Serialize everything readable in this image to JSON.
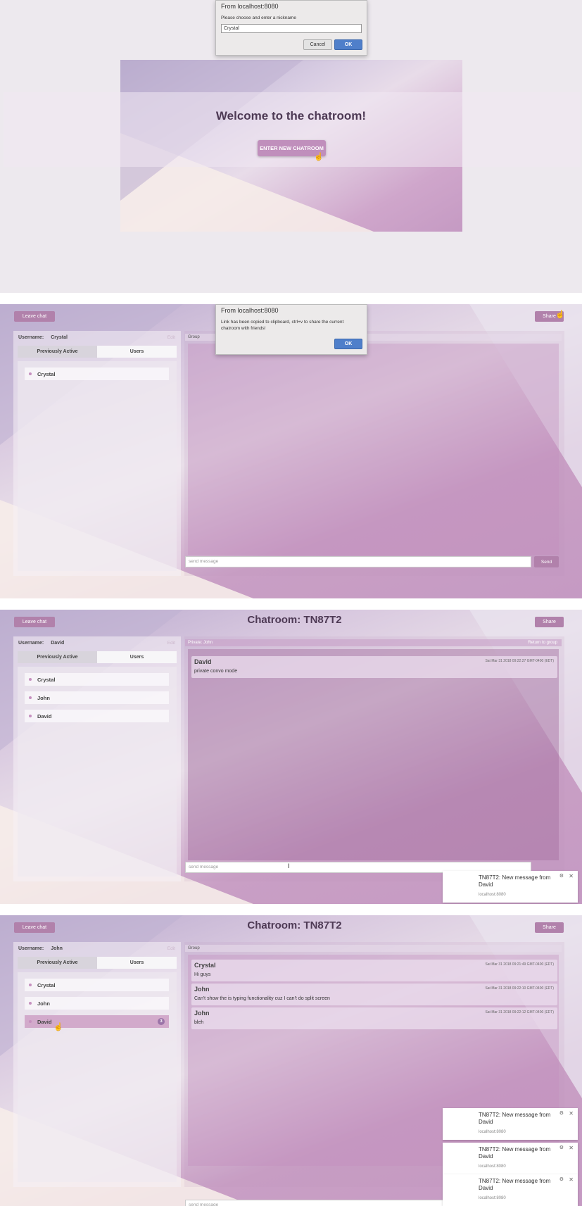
{
  "panel1": {
    "dialog": {
      "title": "From localhost:8080",
      "message": "Please choose and enter a nickname",
      "input_value": "Crystal",
      "cancel": "Cancel",
      "ok": "OK"
    },
    "welcome": "Welcome to the chatroom!",
    "enter_button": "ENTER NEW CHATROOM"
  },
  "panel2": {
    "leave": "Leave chat",
    "share": "Share",
    "dialog": {
      "title": "From localhost:8080",
      "message": "Link has been copied to clipboard, ctrl+v to share the current chatroom with friends!",
      "ok": "OK"
    },
    "username_label": "Username:",
    "username": "Crystal",
    "edit": "Edit",
    "tabs": [
      "Previously Active",
      "Users"
    ],
    "users": [
      "Crystal"
    ],
    "chat_header": "Group",
    "send_placeholder": "send message",
    "send": "Send"
  },
  "panel3": {
    "leave": "Leave chat",
    "title": "Chatroom: TN87T2",
    "share": "Share",
    "username_label": "Username:",
    "username": "David",
    "edit": "Edit",
    "tabs": [
      "Previously Active",
      "Users"
    ],
    "users": [
      "Crystal",
      "John",
      "David"
    ],
    "chat_header": "Private: John",
    "return_link": "Return to group",
    "messages": [
      {
        "who": "David",
        "ts": "Sat Mar 31 2018 09:22:27 GMT-0400 (EDT)",
        "text": "private convo mode"
      }
    ],
    "send_placeholder": "send message",
    "notification": {
      "title": "TN87T2: New message from David",
      "source": "localhost:8080"
    }
  },
  "panel4": {
    "leave": "Leave chat",
    "title": "Chatroom: TN87T2",
    "share": "Share",
    "username_label": "Username:",
    "username": "John",
    "edit": "Edit",
    "tabs": [
      "Previously Active",
      "Users"
    ],
    "users": [
      "Crystal",
      "John",
      "David"
    ],
    "unread_badge": "3",
    "chat_header": "Group",
    "messages": [
      {
        "who": "Crystal",
        "ts": "Sat Mar 31 2018 09:21:49 GMT-0400 (EDT)",
        "text": "Hi guys"
      },
      {
        "who": "John",
        "ts": "Sat Mar 31 2018 09:22:10 GMT-0400 (EDT)",
        "text": "Can't show the is typing functionality cuz I can't do split screen"
      },
      {
        "who": "John",
        "ts": "Sat Mar 31 2018 09:22:12 GMT-0400 (EDT)",
        "text": "bleh"
      }
    ],
    "send_placeholder": "send message",
    "notifications": [
      {
        "title": "TN87T2: New message from David",
        "source": "localhost:8080"
      },
      {
        "title": "TN87T2: New message from David",
        "source": "localhost:8080"
      },
      {
        "title": "TN87T2: New message from David",
        "source": "localhost:8080"
      }
    ]
  },
  "icons": {
    "cursor": "hand-pointer-icon",
    "gear": "gear-icon",
    "close": "close-icon"
  },
  "colors": {
    "accent": "#b181ab",
    "title": "#4e3a55",
    "ok_button": "#4f7fca"
  }
}
